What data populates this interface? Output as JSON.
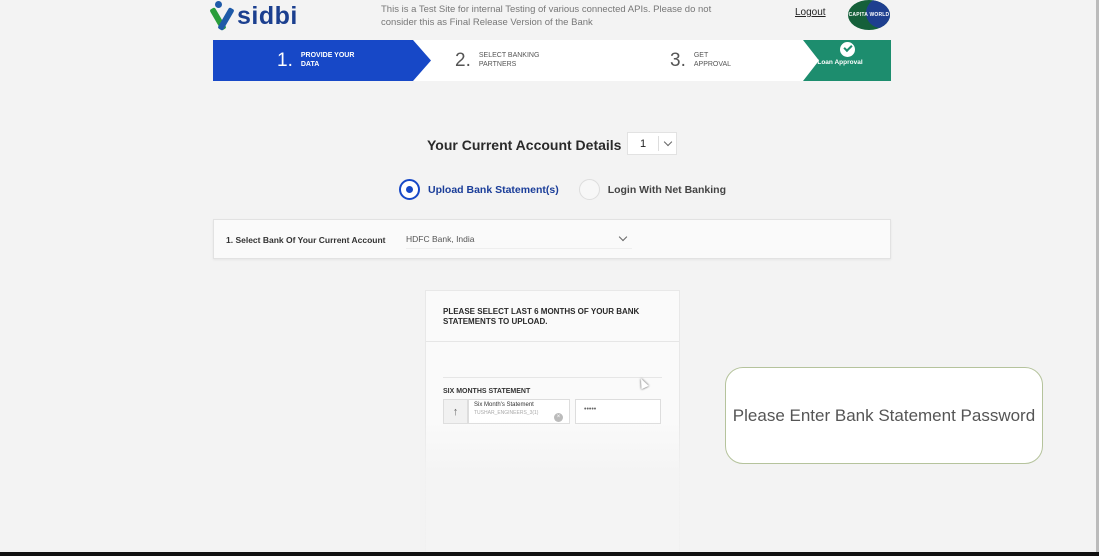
{
  "header": {
    "logo_text": "sidbi",
    "notice": "This is a Test Site for internal Testing of various connected APIs. Please do not consider this as Final Release Version of the Bank",
    "logout_label": "Logout",
    "badge_text": "CAPITA WORLD"
  },
  "steps": [
    {
      "num": "1.",
      "label": "PROVIDE YOUR DATA"
    },
    {
      "num": "2.",
      "label": "SELECT BANKING PARTNERS"
    },
    {
      "num": "3.",
      "label": "GET APPROVAL"
    },
    {
      "num": "",
      "label": "Loan Approval"
    }
  ],
  "account": {
    "title": "Your Current Account Details",
    "count_value": "1"
  },
  "method": {
    "option1": "Upload Bank Statement(s)",
    "option2": "Login With Net Banking",
    "selected": "option1"
  },
  "bank": {
    "label": "1. Select Bank Of Your Current Account",
    "value": "HDFC Bank, India"
  },
  "upload": {
    "title": "PLEASE SELECT LAST 6 MONTHS OF YOUR BANK STATEMENTS TO UPLOAD.",
    "section_label": "SIX MONTHS STATEMENT",
    "file_label": "Six Month's Statement",
    "file_name": "TUSHAR_ENGINEERS_3(1)",
    "password_value": "•••••"
  },
  "callout": {
    "text": "Please Enter Bank Statement Password"
  },
  "colors": {
    "primary": "#1748c7",
    "success": "#1d8d6e",
    "brand": "#1b3f8f"
  }
}
